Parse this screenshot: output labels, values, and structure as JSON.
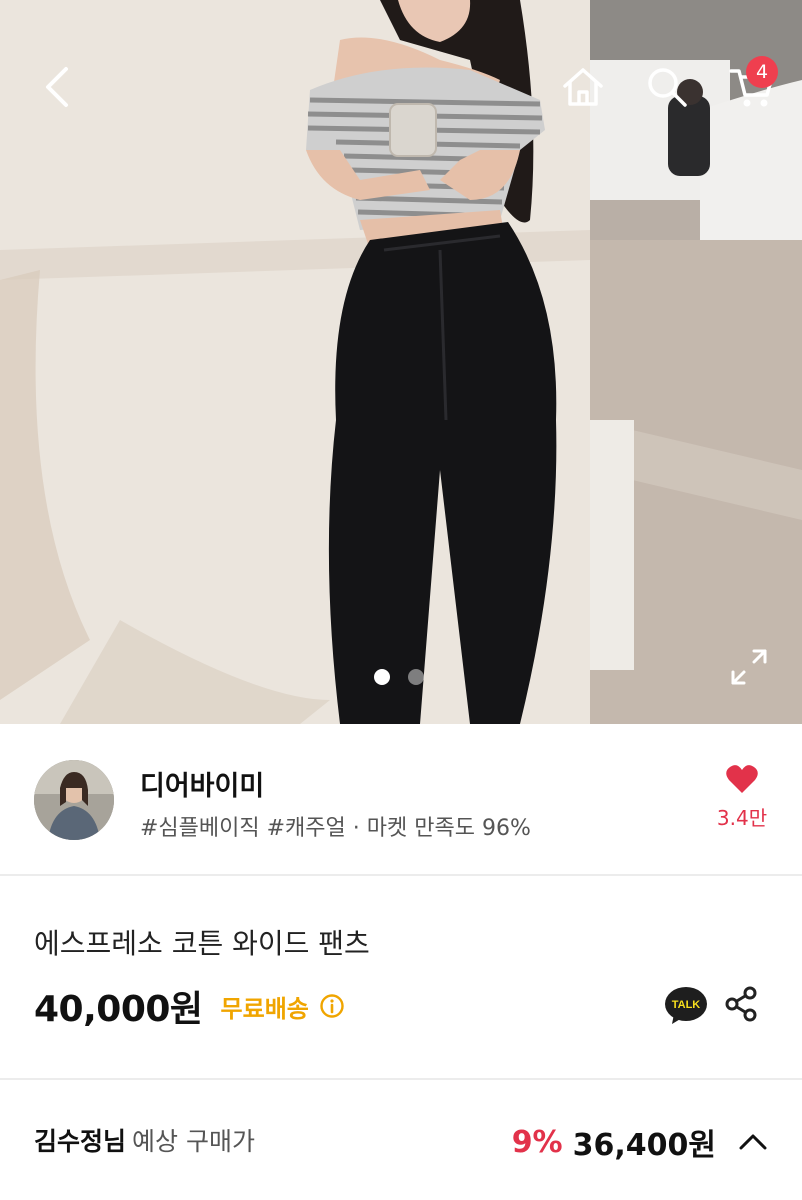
{
  "hero": {
    "cart_count": "4",
    "slide_count": 2,
    "active_slide": 0
  },
  "seller": {
    "name": "디어바이미",
    "tags": "#심플베이직 #캐주얼 · 마켓 만족도 96%",
    "likes": "3.4만"
  },
  "product": {
    "name": "에스프레소 코튼 와이드 팬츠",
    "price": "40,000원",
    "shipping": "무료배송",
    "talk_label": "TALK"
  },
  "purchase": {
    "buyer": "김수정님",
    "label": "예상 구매가",
    "discount": "9%",
    "price": "36,400원"
  },
  "colors": {
    "accent_red": "#e2324a",
    "shipping_gold": "#f0a500",
    "badge_red": "#ef3f4f",
    "kakao_yellow": "#f7df1e"
  }
}
